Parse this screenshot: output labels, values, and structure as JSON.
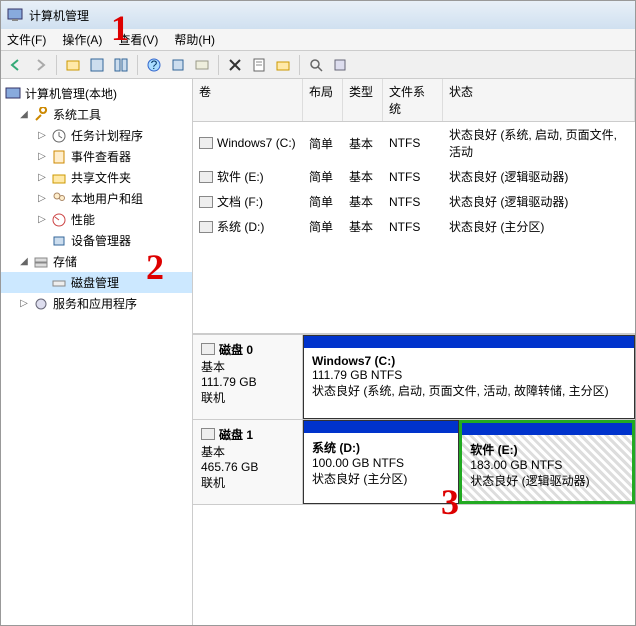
{
  "title": "计算机管理",
  "menu": {
    "file": "文件(F)",
    "action": "操作(A)",
    "view": "查看(V)",
    "help": "帮助(H)"
  },
  "tree": {
    "root": "计算机管理(本地)",
    "systools": "系统工具",
    "scheduler": "任务计划程序",
    "eventviewer": "事件查看器",
    "shared": "共享文件夹",
    "users": "本地用户和组",
    "perf": "性能",
    "devmgr": "设备管理器",
    "storage": "存储",
    "diskmgmt": "磁盘管理",
    "services": "服务和应用程序"
  },
  "vol_headers": {
    "vol": "卷",
    "layout": "布局",
    "type": "类型",
    "fs": "文件系统",
    "status": "状态"
  },
  "volumes": [
    {
      "name": "Windows7 (C:)",
      "layout": "简单",
      "type": "基本",
      "fs": "NTFS",
      "status": "状态良好 (系统, 启动, 页面文件, 活动"
    },
    {
      "name": "软件 (E:)",
      "layout": "简单",
      "type": "基本",
      "fs": "NTFS",
      "status": "状态良好 (逻辑驱动器)"
    },
    {
      "name": "文档 (F:)",
      "layout": "简单",
      "type": "基本",
      "fs": "NTFS",
      "status": "状态良好 (逻辑驱动器)"
    },
    {
      "name": "系统 (D:)",
      "layout": "简单",
      "type": "基本",
      "fs": "NTFS",
      "status": "状态良好 (主分区)"
    }
  ],
  "disks": [
    {
      "name": "磁盘 0",
      "type": "基本",
      "size": "111.79 GB",
      "status": "联机",
      "parts": [
        {
          "name": "Windows7  (C:)",
          "size": "111.79 GB NTFS",
          "status": "状态良好 (系统, 启动, 页面文件, 活动, 故障转储, 主分区)",
          "flex": 1,
          "selected": false
        }
      ]
    },
    {
      "name": "磁盘 1",
      "type": "基本",
      "size": "465.76 GB",
      "status": "联机",
      "parts": [
        {
          "name": "系统  (D:)",
          "size": "100.00 GB NTFS",
          "status": "状态良好 (主分区)",
          "flex": 1,
          "selected": false
        },
        {
          "name": "软件  (E:)",
          "size": "183.00 GB NTFS",
          "status": "状态良好 (逻辑驱动器)",
          "flex": 1.1,
          "selected": true
        }
      ]
    }
  ],
  "annotations": {
    "a1": "1",
    "a2": "2",
    "a3": "3"
  }
}
